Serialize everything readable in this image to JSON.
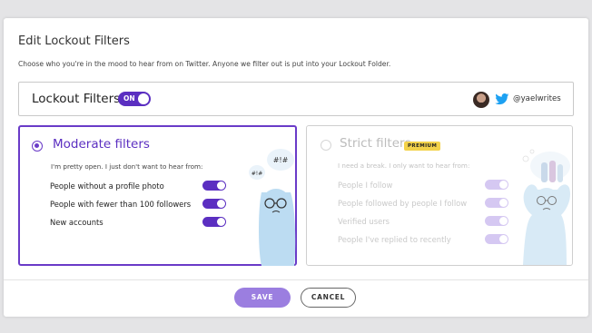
{
  "dialog": {
    "title": "Edit Lockout Filters",
    "subtitle": "Choose who you're in the mood to hear from on Twitter. Anyone we filter out is put into your Lockout Folder."
  },
  "lockout": {
    "label": "Lockout Filters",
    "toggle_text": "ON",
    "toggle_state": "on",
    "account_handle": "@yaelwrites"
  },
  "moderate": {
    "title": "Moderate filters",
    "description": "I'm pretty open. I just don't want to hear from:",
    "selected": true,
    "speech_1": "#!#",
    "speech_2": "#!#",
    "filters": [
      {
        "label": "People without a profile photo",
        "enabled": true
      },
      {
        "label": "People with fewer than 100 followers",
        "enabled": true
      },
      {
        "label": "New accounts",
        "enabled": true
      }
    ]
  },
  "strict": {
    "title": "Strict filters",
    "badge": "PREMIUM",
    "description": "I need a break. I only want to hear from:",
    "selected": false,
    "filters": [
      {
        "label": "People I follow",
        "enabled": true
      },
      {
        "label": "People followed by people I follow",
        "enabled": true
      },
      {
        "label": "Verified users",
        "enabled": true
      },
      {
        "label": "People I've replied to recently",
        "enabled": true
      }
    ]
  },
  "footer": {
    "save_label": "SAVE",
    "cancel_label": "CANCEL"
  },
  "colors": {
    "accent": "#5b2fc1",
    "save_button": "#9b7ee0",
    "premium_badge": "#f3d24a",
    "twitter_blue": "#1da1f2"
  },
  "icons": [
    "twitter-bird-icon",
    "radio-selected-icon",
    "radio-unselected-icon"
  ]
}
